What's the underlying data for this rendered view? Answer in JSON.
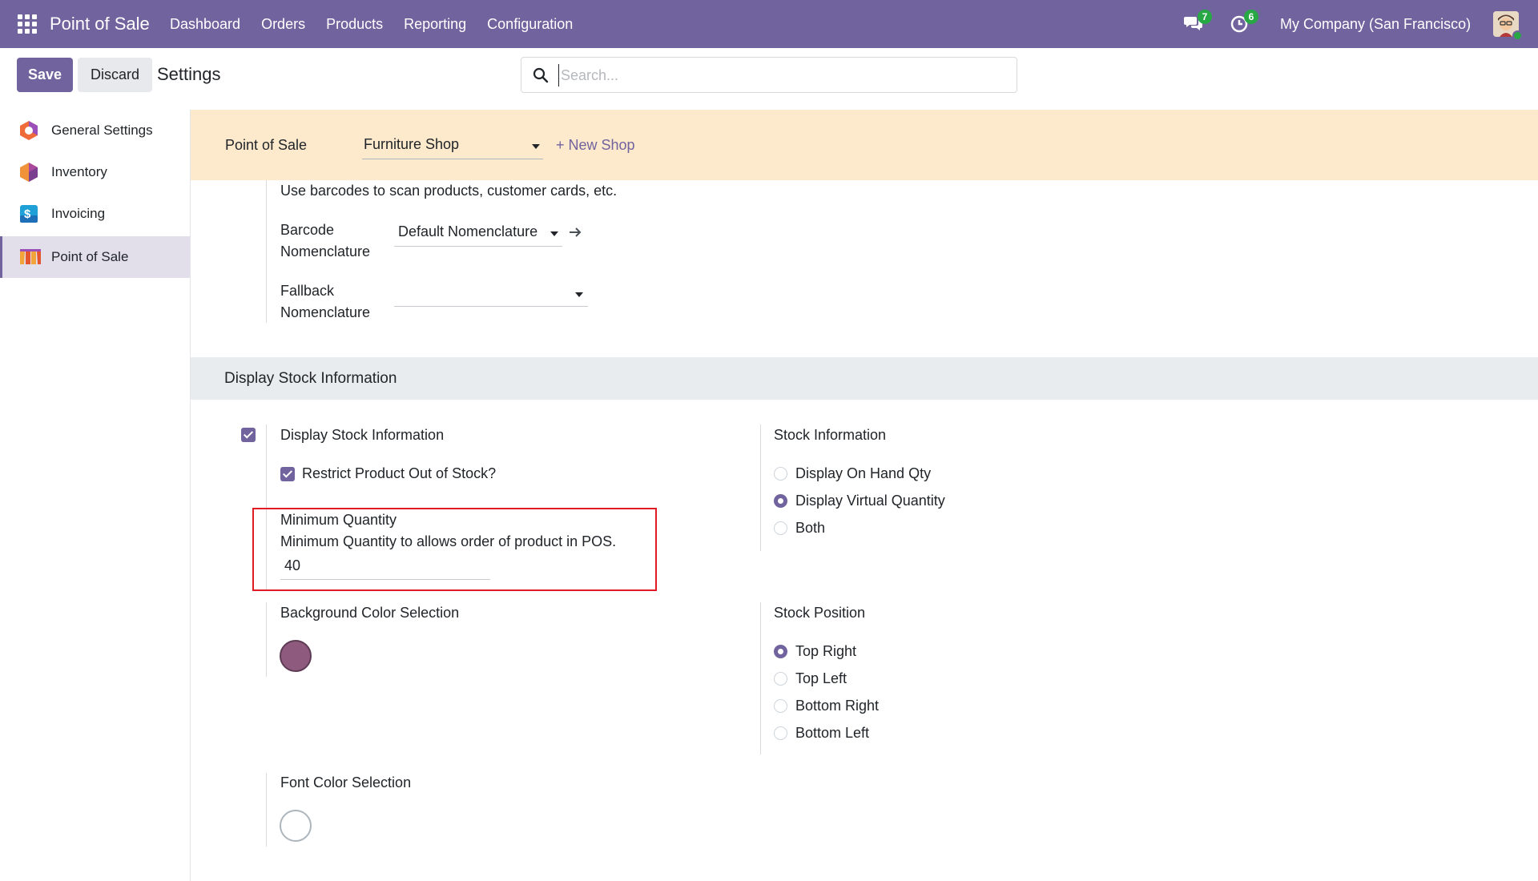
{
  "navbar": {
    "brand": "Point of Sale",
    "menu": [
      "Dashboard",
      "Orders",
      "Products",
      "Reporting",
      "Configuration"
    ],
    "messages_count": "7",
    "activities_count": "6",
    "company": "My Company (San Francisco)",
    "bg_color": "#71639e"
  },
  "control": {
    "save_label": "Save",
    "discard_label": "Discard",
    "breadcrumb": "Settings",
    "search_placeholder": "Search..."
  },
  "sidebar": {
    "items": [
      {
        "label": "General Settings",
        "icon": "odoo-settings-icon"
      },
      {
        "label": "Inventory",
        "icon": "inventory-icon"
      },
      {
        "label": "Invoicing",
        "icon": "invoicing-icon"
      },
      {
        "label": "Point of Sale",
        "icon": "pos-icon",
        "active": true
      }
    ]
  },
  "band": {
    "label": "Point of Sale",
    "shop": "Furniture Shop",
    "new_shop": "+ New Shop",
    "bg_color": "#fde9cc"
  },
  "barcode": {
    "description": "Use barcodes to scan products, customer cards, etc.",
    "nomenclature_label_1": "Barcode",
    "nomenclature_label_2": "Nomenclature",
    "nomenclature_value": "Default Nomenclature",
    "fallback_label_1": "Fallback",
    "fallback_label_2": "Nomenclature",
    "fallback_value": ""
  },
  "stock": {
    "section_title": "Display Stock Information",
    "display_stock_label": "Display Stock Information",
    "display_stock_checked": true,
    "restrict_label": "Restrict Product Out of Stock?",
    "restrict_checked": true,
    "min_qty_label": "Minimum Quantity",
    "min_qty_help": "Minimum Quantity to allows order of product in POS.",
    "min_qty_value": "40",
    "stock_info_title": "Stock Information",
    "stock_info_options": [
      "Display On Hand Qty",
      "Display Virtual Quantity",
      "Both"
    ],
    "stock_info_selected": 1,
    "bg_color_label": "Background Color Selection",
    "bg_color_value": "#8e5b7e",
    "stock_position_title": "Stock Position",
    "stock_position_options": [
      "Top Right",
      "Top Left",
      "Bottom Right",
      "Bottom Left"
    ],
    "stock_position_selected": 0,
    "font_color_label": "Font Color Selection",
    "font_color_value": "#ffffff"
  }
}
